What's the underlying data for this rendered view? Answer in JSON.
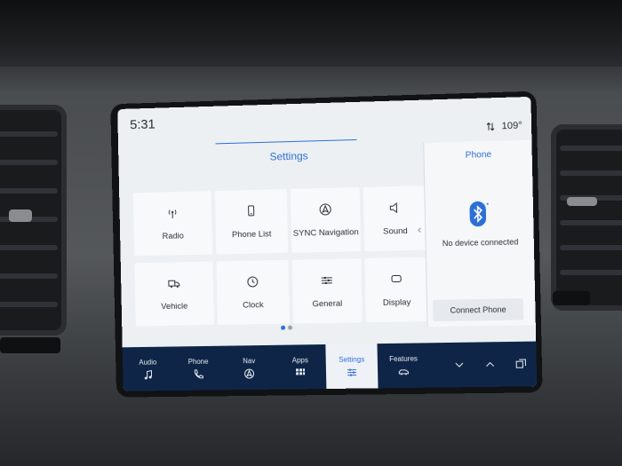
{
  "status": {
    "time": "5:31",
    "signal_icon": "signal-arrows-icon",
    "temperature": "109°"
  },
  "settings": {
    "title": "Settings",
    "tiles": [
      {
        "label": "Radio",
        "icon": "radio-antenna-icon"
      },
      {
        "label": "Phone List",
        "icon": "phone-icon"
      },
      {
        "label": "SYNC Navigation",
        "icon": "navigation-icon"
      },
      {
        "label": "Sound",
        "icon": "speaker-icon"
      },
      {
        "label": "Vehicle",
        "icon": "vehicle-icon"
      },
      {
        "label": "Clock",
        "icon": "clock-icon"
      },
      {
        "label": "General",
        "icon": "sliders-icon"
      },
      {
        "label": "Display",
        "icon": "display-icon"
      }
    ],
    "page_indicator": {
      "pages": 2,
      "current": 1
    }
  },
  "phone_panel": {
    "title": "Phone",
    "icon": "bluetooth-icon",
    "status": "No device connected",
    "connect_label": "Connect Phone"
  },
  "bottom_nav": {
    "items": [
      {
        "label": "Audio",
        "icon": "music-note-icon"
      },
      {
        "label": "Phone",
        "icon": "phone-icon"
      },
      {
        "label": "Nav",
        "icon": "navigation-icon"
      },
      {
        "label": "Apps",
        "icon": "apps-grid-icon"
      },
      {
        "label": "Settings",
        "icon": "settings-sliders-icon",
        "active": true
      },
      {
        "label": "Features",
        "icon": "vehicle-icon"
      }
    ],
    "extra_icons": [
      "chevron-down-icon",
      "chevron-up-icon",
      "window-stack-icon"
    ]
  },
  "colors": {
    "accent": "#2e6fd6",
    "bar": "#0e2547",
    "screen_bg": "#ecf0f3"
  }
}
